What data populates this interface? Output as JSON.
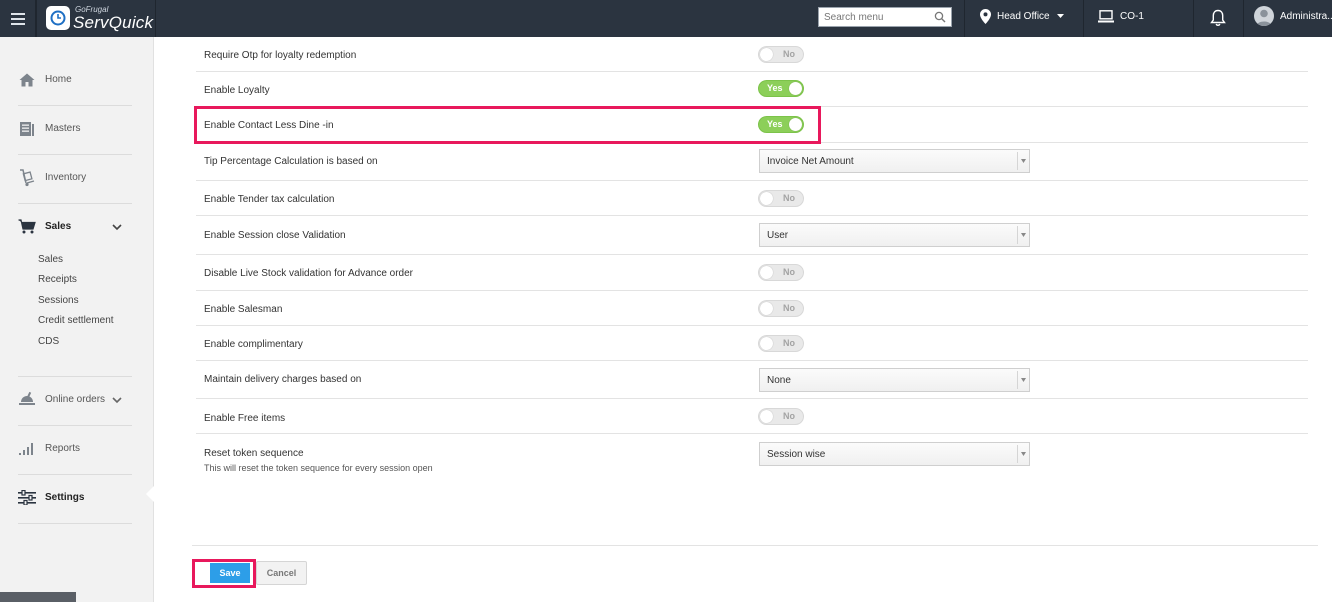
{
  "app": {
    "brand_small": "GoFrugal",
    "brand_name": "ServQuick"
  },
  "topbar": {
    "search_placeholder": "Search menu",
    "location": "Head Office",
    "counter": "CO-1",
    "user": "Administra..."
  },
  "sidebar": {
    "items": [
      {
        "label": "Home",
        "icon": "home-icon"
      },
      {
        "label": "Masters",
        "icon": "masters-icon"
      },
      {
        "label": "Inventory",
        "icon": "inventory-icon"
      },
      {
        "label": "Sales",
        "icon": "cart-icon"
      },
      {
        "label": "Online orders",
        "icon": "online-orders-icon"
      },
      {
        "label": "Reports",
        "icon": "bar-chart-icon"
      },
      {
        "label": "Settings",
        "icon": "settings-sliders-icon"
      }
    ],
    "sales_sub": [
      "Sales",
      "Receipts",
      "Sessions",
      "Credit settlement",
      "CDS"
    ]
  },
  "settings": {
    "rows": [
      {
        "label": "Require Otp for loyalty redemption",
        "control": "toggle",
        "value": "No"
      },
      {
        "label": "Enable Loyalty",
        "control": "toggle",
        "value": "Yes"
      },
      {
        "label": "Enable Contact Less Dine -in",
        "control": "toggle",
        "value": "Yes",
        "highlighted": true
      },
      {
        "label": "Tip Percentage Calculation is based on",
        "control": "select",
        "value": "Invoice Net Amount"
      },
      {
        "label": "Enable Tender tax calculation",
        "control": "toggle",
        "value": "No"
      },
      {
        "label": "Enable Session close Validation",
        "control": "select",
        "value": "User"
      },
      {
        "label": "Disable Live Stock validation for Advance order",
        "control": "toggle",
        "value": "No"
      },
      {
        "label": "Enable Salesman",
        "control": "toggle",
        "value": "No"
      },
      {
        "label": "Enable complimentary",
        "control": "toggle",
        "value": "No"
      },
      {
        "label": "Maintain delivery charges based on",
        "control": "select",
        "value": "None"
      },
      {
        "label": "Enable Free items",
        "control": "toggle",
        "value": "No"
      },
      {
        "label": "Reset token sequence",
        "sublabel": "This will reset the token sequence for every session open",
        "control": "select",
        "value": "Session wise"
      }
    ]
  },
  "actions": {
    "save": "Save",
    "cancel": "Cancel"
  },
  "colors": {
    "topbar": "#2b3440",
    "toggle_on": "#8ccf59",
    "primary": "#2d9ee8",
    "highlight": "#e8185c"
  }
}
